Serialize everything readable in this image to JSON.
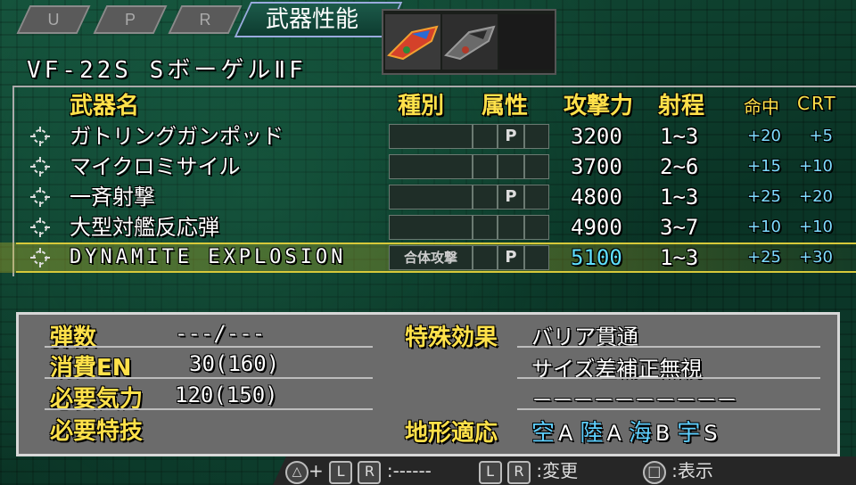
{
  "tabs": [
    "U",
    "P",
    "R"
  ],
  "screen_title": "武器性能",
  "unit_name": "VF-22S  SボーゲルⅡF",
  "headers": {
    "weapon": "武器名",
    "type": "種別",
    "attribute": "属性",
    "attack": "攻撃力",
    "range": "射程",
    "hit": "命中",
    "crt": "CRT"
  },
  "weapons": [
    {
      "name": "ガトリングガンポッド",
      "type": "",
      "attr": "P",
      "attack": "3200",
      "range": "1~3",
      "hit": "+20",
      "crt": "+5",
      "selected": false
    },
    {
      "name": "マイクロミサイル",
      "type": "",
      "attr": "",
      "attack": "3700",
      "range": "2~6",
      "hit": "+15",
      "crt": "+10",
      "selected": false
    },
    {
      "name": "一斉射撃",
      "type": "",
      "attr": "P",
      "attack": "4800",
      "range": "1~3",
      "hit": "+25",
      "crt": "+20",
      "selected": false
    },
    {
      "name": "大型対艦反応弾",
      "type": "",
      "attr": "",
      "attack": "4900",
      "range": "3~7",
      "hit": "+10",
      "crt": "+10",
      "selected": false
    },
    {
      "name": "DYNAMITE EXPLOSION",
      "type": "合体攻撃",
      "attr": "P",
      "attack": "5100",
      "range": "1~3",
      "hit": "+25",
      "crt": "+30",
      "selected": true
    }
  ],
  "info": {
    "ammo_label": "弾数",
    "ammo_value": "---/---",
    "en_label": "消費EN",
    "en_value": "30(160)",
    "will_label": "必要気力",
    "will_value": "120(150)",
    "skill_label": "必要特技",
    "skill_value": "",
    "effect_label": "特殊効果",
    "effects": [
      "バリア貫通",
      "サイズ差補正無視",
      "－－－－－－－－－－"
    ],
    "terrain_label": "地形適応",
    "terrain": [
      {
        "name": "空",
        "rank": "A"
      },
      {
        "name": "陸",
        "rank": "A"
      },
      {
        "name": "海",
        "rank": "B"
      },
      {
        "name": "宇",
        "rank": "S"
      }
    ]
  },
  "footer": {
    "combo_buttons": [
      "L",
      "R"
    ],
    "combo_text": ":------",
    "change_buttons": [
      "L",
      "R"
    ],
    "change_text": ":変更",
    "display_button": "□",
    "display_text": ":表示"
  },
  "colors": {
    "highlight_attack": "#5fe0ff",
    "header_yellow": "#ffe14a",
    "bonus_blue": "#7fdcff",
    "terrain_blue": "#5fd0ff"
  }
}
